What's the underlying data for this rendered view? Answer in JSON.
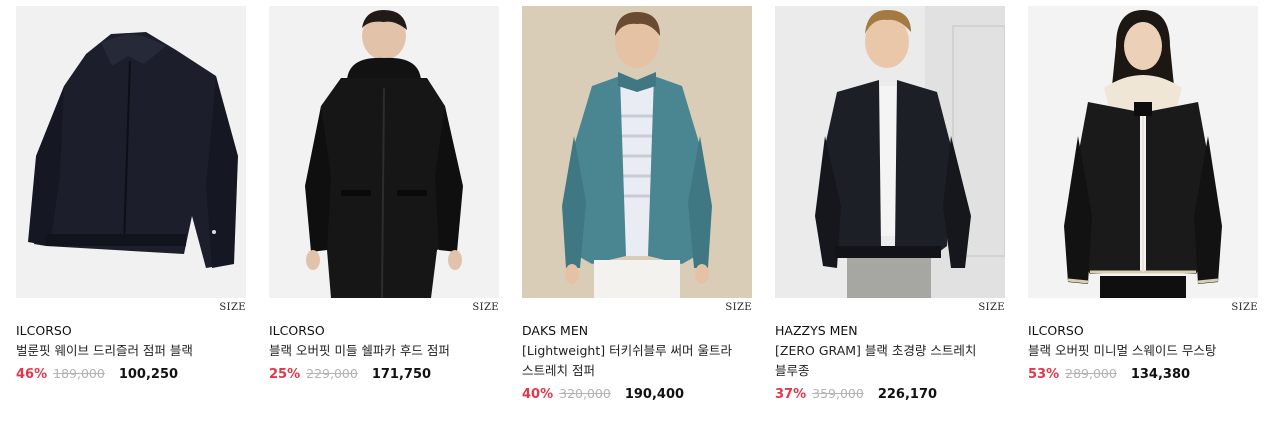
{
  "products": [
    {
      "size_label": "SIZE",
      "brand": "ILCORSO",
      "name": "벌룬핏 웨이브 드리즐러 점퍼 블랙",
      "discount": "46%",
      "original_price": "189,000",
      "final_price": "100,250",
      "image_icon": "black-drizzler-jacket-image",
      "bg_color": "#f1f1f1"
    },
    {
      "size_label": "SIZE",
      "brand": "ILCORSO",
      "name": "블랙 오버핏 미들 쉘파카 후드 점퍼",
      "discount": "25%",
      "original_price": "229,000",
      "final_price": "171,750",
      "image_icon": "black-hooded-parka-image",
      "bg_color": "#f2f2f2"
    },
    {
      "size_label": "SIZE",
      "brand": "DAKS MEN",
      "name": "[Lightweight] 터키쉬블루 써머 울트라 스트레치 점퍼",
      "discount": "40%",
      "original_price": "320,000",
      "final_price": "190,400",
      "image_icon": "blue-summer-jacket-image",
      "bg_color": "#d9cdb8"
    },
    {
      "size_label": "SIZE",
      "brand": "HAZZYS MEN",
      "name": "[ZERO GRAM] 블랙 초경량 스트레치 블루종",
      "discount": "37%",
      "original_price": "359,000",
      "final_price": "226,170",
      "image_icon": "black-blouson-image",
      "bg_color": "#ebebeb"
    },
    {
      "size_label": "SIZE",
      "brand": "ILCORSO",
      "name": "블랙 오버핏 미니멀 스웨이드 무스탕",
      "discount": "53%",
      "original_price": "289,000",
      "final_price": "134,380",
      "image_icon": "black-suede-mustang-image",
      "bg_color": "#f3f3f3"
    }
  ],
  "colors": {
    "discount": "#e0384a",
    "original_price": "#b3b3b3",
    "text": "#111111"
  }
}
